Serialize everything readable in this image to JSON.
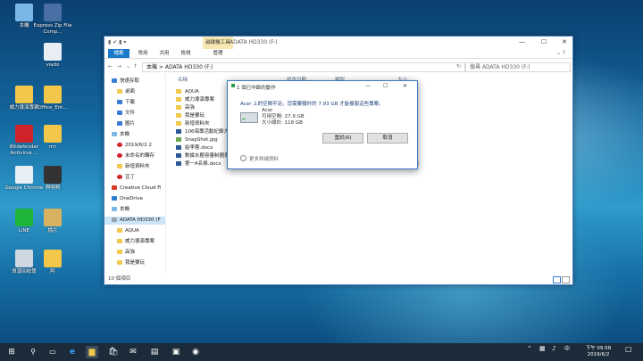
{
  "desktop": {
    "icons": [
      {
        "label": "本機",
        "color": "#7ab7e6"
      },
      {
        "label": "Express Zip File Comp...",
        "color": "#4a6fa5"
      },
      {
        "label": "viado",
        "color": "#e9eef5"
      },
      {
        "label": "威力導演專案",
        "color": "#f3c84a"
      },
      {
        "label": "Office_Ent...",
        "color": "#f3c84a"
      },
      {
        "label": "Bitdefender Antivirus ...",
        "color": "#d0232a"
      },
      {
        "label": "rrrr",
        "color": "#f3c84a"
      },
      {
        "label": "Google Chrome",
        "color": "#e8eef5"
      },
      {
        "label": "啊啊啊",
        "color": "#333333"
      },
      {
        "label": "LINE",
        "color": "#1fb53a"
      },
      {
        "label": "檔片",
        "color": "#d8b260"
      },
      {
        "label": "資源回收筒",
        "color": "#cfd8e0"
      },
      {
        "label": "阿",
        "color": "#f3c84a"
      }
    ]
  },
  "explorer": {
    "tool_group": "磁碟機工具",
    "title": "ADATA HD330 (F:)",
    "tabs": [
      "檔案",
      "常用",
      "共用",
      "檢視",
      "管理"
    ],
    "address": "本機 > ADATA HD330 (F:)",
    "search_placeholder": "搜尋 ADATA HD330 (F:)",
    "columns": [
      "名稱",
      "修改日期",
      "類型",
      "大小"
    ],
    "sidebar": [
      {
        "label": "快速存取",
        "type": "star"
      },
      {
        "label": "桌面",
        "type": "folder"
      },
      {
        "label": "下載",
        "type": "download"
      },
      {
        "label": "文件",
        "type": "doc"
      },
      {
        "label": "圖片",
        "type": "pic"
      },
      {
        "label": "本機",
        "type": "pc"
      },
      {
        "label": "2019/6/2 2",
        "type": "error"
      },
      {
        "label": "未命名的轉存",
        "type": "error"
      },
      {
        "label": "新增資料夾",
        "type": "folder"
      },
      {
        "label": "豆丁",
        "type": "error"
      },
      {
        "label": "Creative Cloud Fi",
        "type": "cc"
      },
      {
        "label": "OneDrive",
        "type": "cloud"
      },
      {
        "label": "本機",
        "type": "pc"
      },
      {
        "label": "ADATA HD330 (F",
        "type": "drive"
      },
      {
        "label": "AQUA",
        "type": "folder"
      },
      {
        "label": "威力導演專案",
        "type": "folder"
      },
      {
        "label": "高強",
        "type": "folder"
      },
      {
        "label": "我是要玩",
        "type": "folder"
      }
    ],
    "files": [
      {
        "name": "AQUA",
        "type": "folder"
      },
      {
        "name": "威力導演專案",
        "type": "folder"
      },
      {
        "name": "高強",
        "type": "folder"
      },
      {
        "name": "我是要玩",
        "type": "folder"
      },
      {
        "name": "新增資料夾",
        "type": "folder"
      },
      {
        "name": "106海專活動紀錄大",
        "type": "doc"
      },
      {
        "name": "SnapShot.jpg",
        "type": "img"
      },
      {
        "name": "給李蓉.docx",
        "type": "doc"
      },
      {
        "name": "數據水壓容量制圖表",
        "type": "doc"
      },
      {
        "name": "第一A名條.docx",
        "type": "doc",
        "date": "2013/3/6 下午 11:...",
        "kind": "Microsoft Office ...",
        "size": "17 KB"
      }
    ],
    "status": "10 個項目"
  },
  "dialog": {
    "title": "1 個已中斷的動作",
    "message": "Acer 上的空間不足。您需要額外的 7.93 GB 才能複製這些專案。",
    "drive_name": "Acer",
    "free": "可用空間: 27.9 GB",
    "total": "大小總計: 118 GB",
    "retry": "重試(R)",
    "cancel": "取消",
    "more": "更多詳細資料"
  },
  "taskbar": {
    "time": "下午 09:58",
    "date": "2019/6/2"
  }
}
